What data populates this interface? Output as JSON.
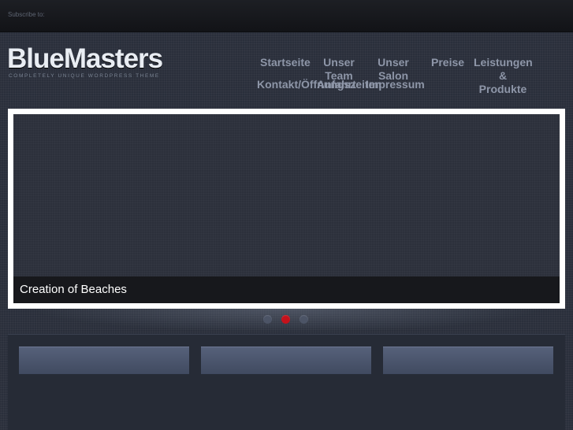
{
  "header": {
    "subscribe_label": "Subscribe to:"
  },
  "logo": {
    "name": "BlueMasters",
    "tagline": "COMPLETELY UNIQUE WORDPRESS THEME"
  },
  "nav": {
    "items": [
      {
        "label": "Startseite"
      },
      {
        "label": "Unser Team"
      },
      {
        "label": "Unser Salon"
      },
      {
        "label": "Preise"
      },
      {
        "label": "Leistungen & Produkte"
      },
      {
        "label": "Kontakt/Öffnungszeiten"
      },
      {
        "label": "Anfahrt"
      },
      {
        "label": "Impressum"
      }
    ]
  },
  "slider": {
    "caption": "Creation of Beaches",
    "slides": 3,
    "active_slide": 2
  },
  "colors": {
    "accent_active_dot": "#c4121c",
    "background": "#2a2f3b",
    "frame": "#ffffff"
  }
}
